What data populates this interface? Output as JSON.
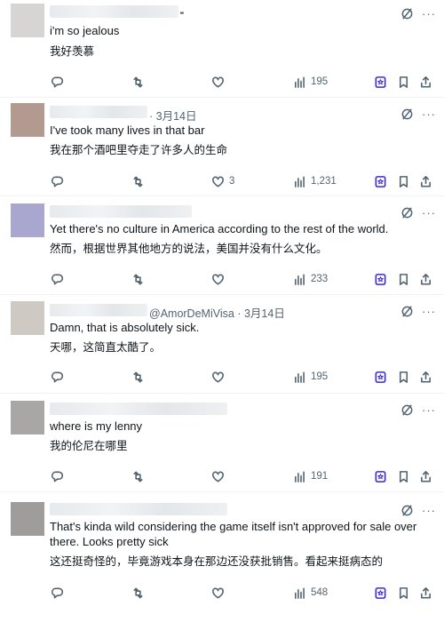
{
  "replies": [
    {
      "handle": "",
      "date": "",
      "text_en": "i'm so jealous",
      "text_zh": "我好羡慕",
      "likes": "",
      "views": "195"
    },
    {
      "handle": "",
      "date": "3月14日",
      "text_en": "I've took many lives in that bar",
      "text_zh": "我在那个酒吧里夺走了许多人的生命",
      "likes": "3",
      "views": "1,231"
    },
    {
      "handle": "",
      "date": "",
      "text_en": "Yet there's no culture in America according to the rest of the world.",
      "text_zh": "然而，根据世界其他地方的说法，美国并没有什么文化。",
      "likes": "",
      "views": "233"
    },
    {
      "handle": "@AmorDeMiVisa",
      "date": "3月14日",
      "text_en": "Damn, that is absolutely sick.",
      "text_zh": "天哪，这简直太酷了。",
      "likes": "",
      "views": "195"
    },
    {
      "handle": "",
      "date": "",
      "text_en": "where is my lenny",
      "text_zh": "我的伦尼在哪里",
      "likes": "",
      "views": "191"
    },
    {
      "handle": "",
      "date": "",
      "text_en": "That's kinda wild considering the game itself isn't approved for sale over there. Looks pretty sick",
      "text_zh": "这还挺奇怪的，毕竟游戏本身在那边还没获批销售。看起来挺病态的",
      "likes": "",
      "views": "548"
    }
  ],
  "separator": "·",
  "icons": {
    "reply": "reply-icon",
    "retweet": "retweet-icon",
    "like": "heart-icon",
    "views": "views-icon",
    "grok_save": "grok-bookmark-icon",
    "bookmark": "bookmark-icon",
    "share": "share-icon",
    "grok": "grok-icon",
    "more": "more-icon"
  },
  "colors": {
    "text": "#0f1419",
    "muted": "#536471",
    "accent": "#3b2bd6",
    "divider": "#eff3f4"
  }
}
